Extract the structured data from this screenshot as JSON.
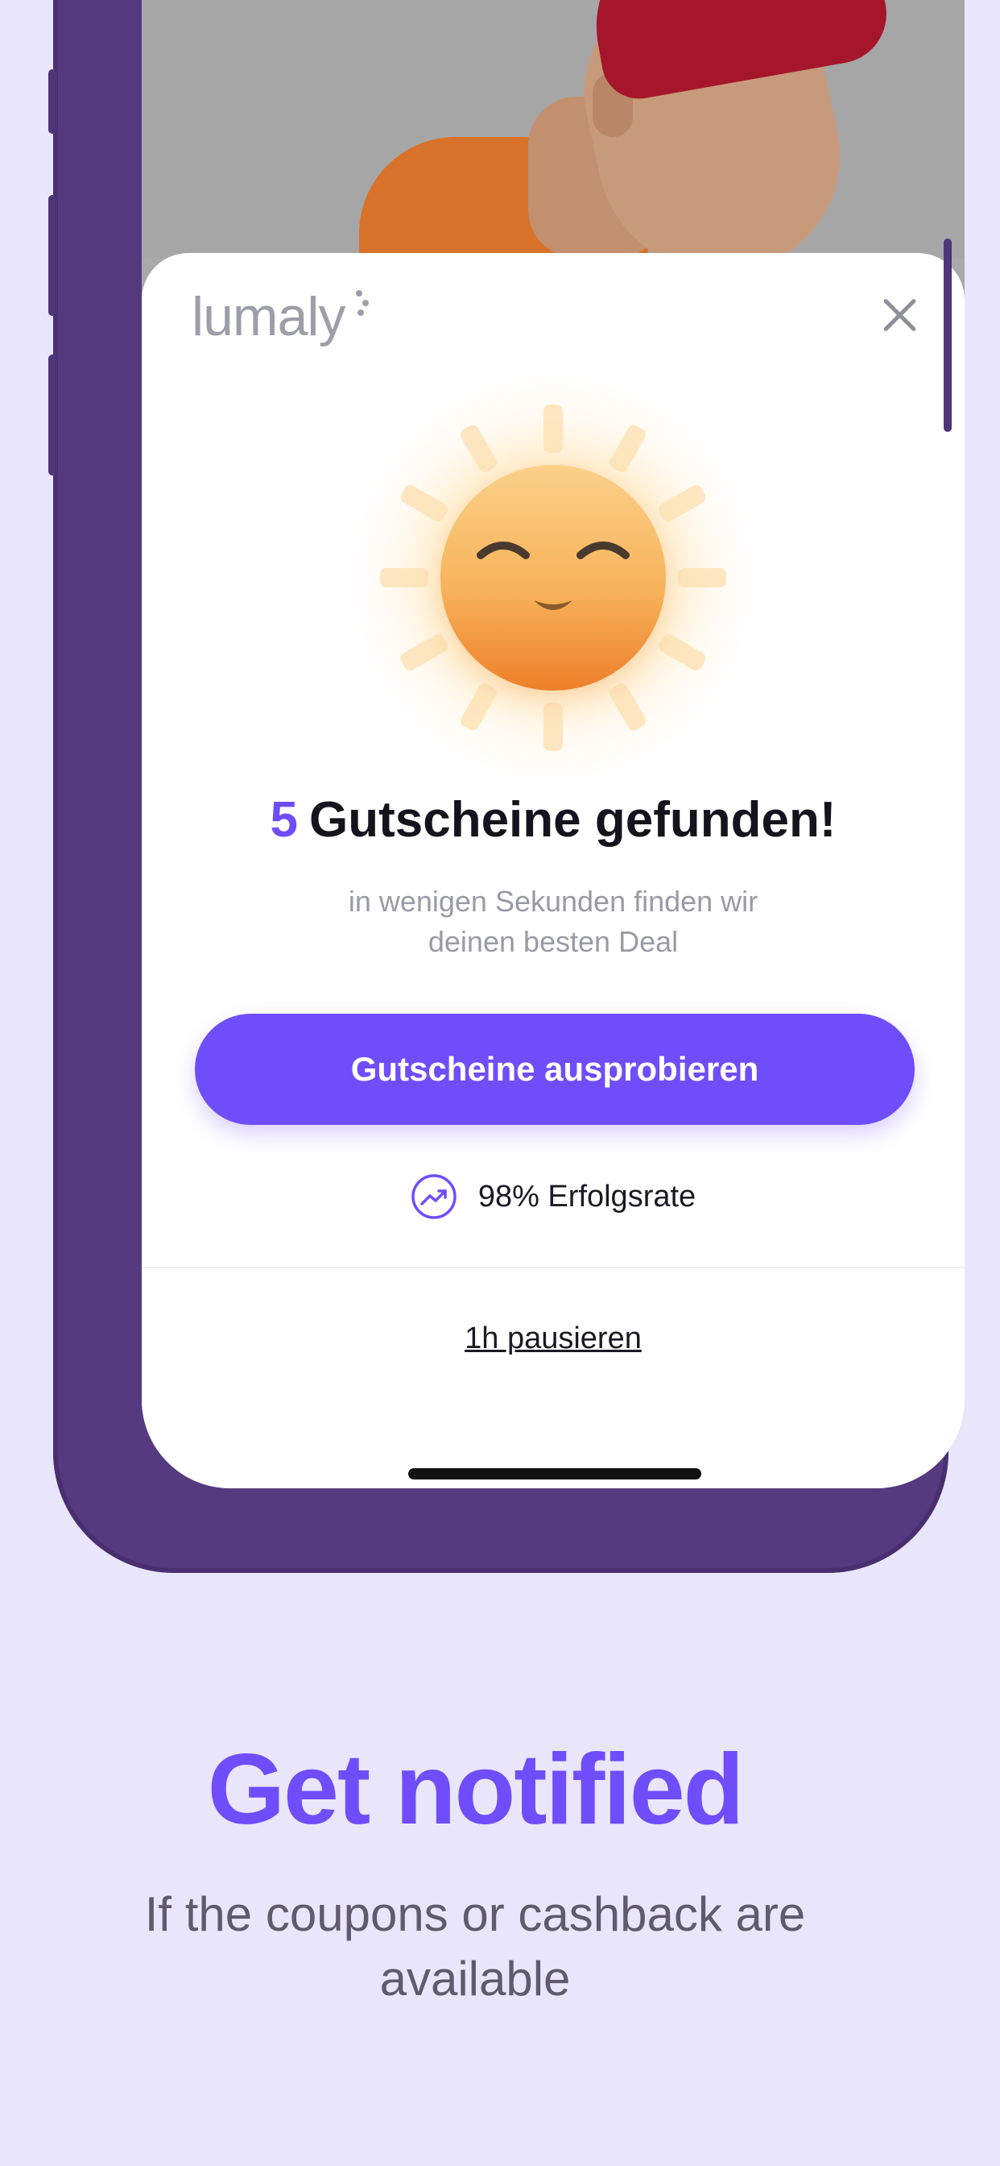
{
  "popup": {
    "logo": "lumaly",
    "coupon_count": "5",
    "title": "Gutscheine gefunden!",
    "subtitle_line1": "in wenigen Sekunden finden wir",
    "subtitle_line2": "deinen besten Deal",
    "cta_label": "Gutscheine ausprobieren",
    "success_rate": "98% Erfolgsrate",
    "pause_label": "1h pausieren"
  },
  "marketing": {
    "headline": "Get notified",
    "tagline_line1": "If the coupons or cashback are",
    "tagline_line2": "available"
  },
  "colors": {
    "accent": "#6f4dfb",
    "background": "#e9e6fc",
    "phone_frame": "#563a80"
  },
  "icons": [
    "close-icon",
    "sun-smiley-icon",
    "trending-up-icon"
  ]
}
